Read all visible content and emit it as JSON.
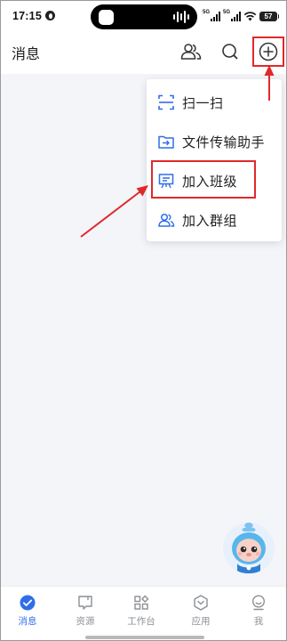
{
  "status_bar": {
    "time": "17:15",
    "signal_1_label": "5G",
    "signal_2_label": "5G",
    "battery": "57"
  },
  "header": {
    "title": "消息",
    "icons": [
      "contacts-icon",
      "search-icon",
      "plus-circle-icon"
    ]
  },
  "menu": {
    "items": [
      {
        "label": "扫一扫",
        "icon": "scan-icon"
      },
      {
        "label": "文件传输助手",
        "icon": "file-transfer-icon"
      },
      {
        "label": "加入班级",
        "icon": "class-board-icon"
      },
      {
        "label": "加入群组",
        "icon": "group-icon"
      }
    ]
  },
  "bottom_nav": {
    "items": [
      {
        "label": "消息",
        "icon": "message-icon",
        "active": true
      },
      {
        "label": "资源",
        "icon": "resource-icon",
        "active": false
      },
      {
        "label": "工作台",
        "icon": "workbench-icon",
        "active": false
      },
      {
        "label": "应用",
        "icon": "apps-icon",
        "active": false
      },
      {
        "label": "我",
        "icon": "profile-icon",
        "active": false
      }
    ]
  },
  "colors": {
    "accent": "#2f6ee8",
    "annotation_red": "#e0292b",
    "content_bg": "#f3f5f9",
    "nav_inactive": "#8c8f94"
  }
}
